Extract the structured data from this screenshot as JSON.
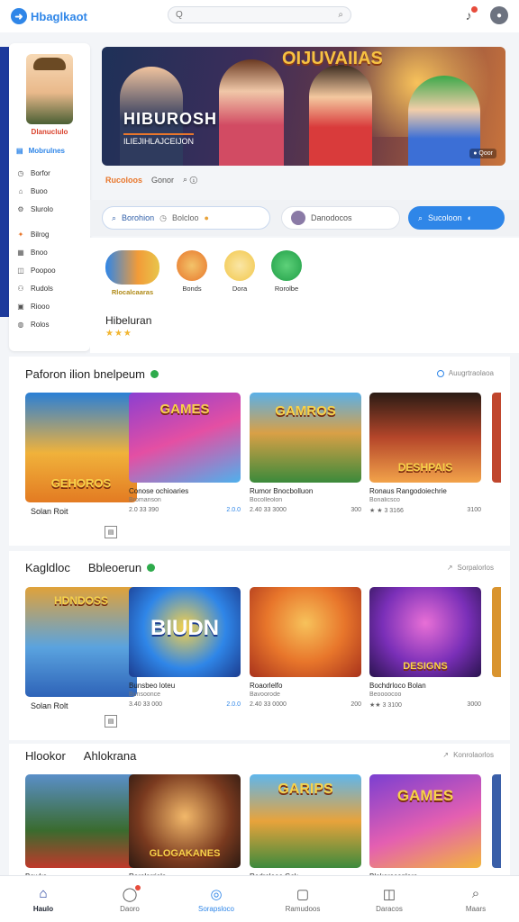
{
  "header": {
    "logo_text": "Hbaglkaot",
    "search_placeholder": "Q",
    "search_right_glyph": "⌕"
  },
  "sidebar": {
    "profile_name": "Dlanuclulo",
    "section_label": "Mobrulnes",
    "items_group1": [
      {
        "label": "Borfor",
        "icon": "history-icon"
      },
      {
        "label": "Buoo",
        "icon": "home-icon"
      },
      {
        "label": "Slurolo",
        "icon": "settings-icon"
      }
    ],
    "items_group2": [
      {
        "label": "Bilrog",
        "icon": "fire-icon"
      },
      {
        "label": "Bnoo",
        "icon": "calendar-icon"
      },
      {
        "label": "Poopoo",
        "icon": "gift-icon"
      },
      {
        "label": "Rudols",
        "icon": "people-icon"
      },
      {
        "label": "Riooo",
        "icon": "grid-icon"
      },
      {
        "label": "Rolos",
        "icon": "globe-icon"
      }
    ]
  },
  "hero": {
    "logo": "OIJUVAIIAS",
    "title": "HIBUROSH",
    "subtitle": "ILIEJIHLAJCEIJON",
    "badge": "● Qoor",
    "tab_active": "Rucoloos",
    "tab_2": "Gonor",
    "tab_3": "⌕ ⓘ"
  },
  "filters": {
    "pill_a": "Borohion",
    "pill_a_extra": "Bolcloo",
    "pill_b": "Danodocos",
    "pill_c": "Sucoloon"
  },
  "categories": [
    {
      "label": "Rlocalcaaras"
    },
    {
      "label": "Bonds"
    },
    {
      "label": "Dora"
    },
    {
      "label": "Rorolbe"
    }
  ],
  "feature": {
    "name": "Hibeluran",
    "stars": "★★★"
  },
  "section1": {
    "title": "Paforon ilion bnelpeum",
    "link": "Auugrtraolaoa",
    "first_label": "Solan Roit",
    "cards": [
      {
        "name": "Conose ochioaries",
        "sub": "Bromanson",
        "meta_left": "2.0 33 390",
        "meta_right": "2.0.0"
      },
      {
        "name": "Rumor Bnocbolluon",
        "sub": "Bocolleolon",
        "meta_left": "2.40 33 3000",
        "meta_right": "300"
      },
      {
        "name": "Ronaus Rangodoiechrie",
        "sub": "Bonalicsco",
        "meta_left": "★ ★ 3 3166",
        "meta_right": "3100"
      }
    ]
  },
  "section2": {
    "title": "Kagldloc",
    "title2": "Bbleoerun",
    "link": "Sorpalorlos",
    "first_label": "Solan Rolt",
    "cards": [
      {
        "name": "Bunsbeo loteu",
        "sub": "Bunsoonce",
        "meta_left": "3.40 33 000",
        "meta_right": "2.0.0"
      },
      {
        "name": "Roaorlelfo",
        "sub": "Bavoorode",
        "meta_left": "2.40 33 0000",
        "meta_right": "200"
      },
      {
        "name": "Bochdrloco Bolan",
        "sub": "Beoooocoo",
        "meta_left": "★★ 3 3100",
        "meta_right": "3000"
      }
    ]
  },
  "section3": {
    "title": "Hlookor",
    "title2": "Ahlokrana",
    "link": "Konrolaorlos",
    "cards": [
      {
        "name": "Bowko"
      },
      {
        "name": "Rorolarriola"
      },
      {
        "name": "Rodrolooo Gok"
      },
      {
        "name": "Blokorosonloro"
      }
    ]
  },
  "nav": [
    {
      "label": "Haulo",
      "icon": "home-icon",
      "active": true
    },
    {
      "label": "Daoro",
      "icon": "chat-icon"
    },
    {
      "label": "Sorapsloco",
      "icon": "compass-icon",
      "blue": true
    },
    {
      "label": "Ramudoos",
      "icon": "bookmark-icon"
    },
    {
      "label": "Daracos",
      "icon": "trophy-icon"
    },
    {
      "label": "Maars",
      "icon": "search-icon"
    }
  ],
  "colors": {
    "accent": "#2f86e8",
    "sidebar_accent": "#1d3a9c",
    "orange": "#e8762b"
  }
}
